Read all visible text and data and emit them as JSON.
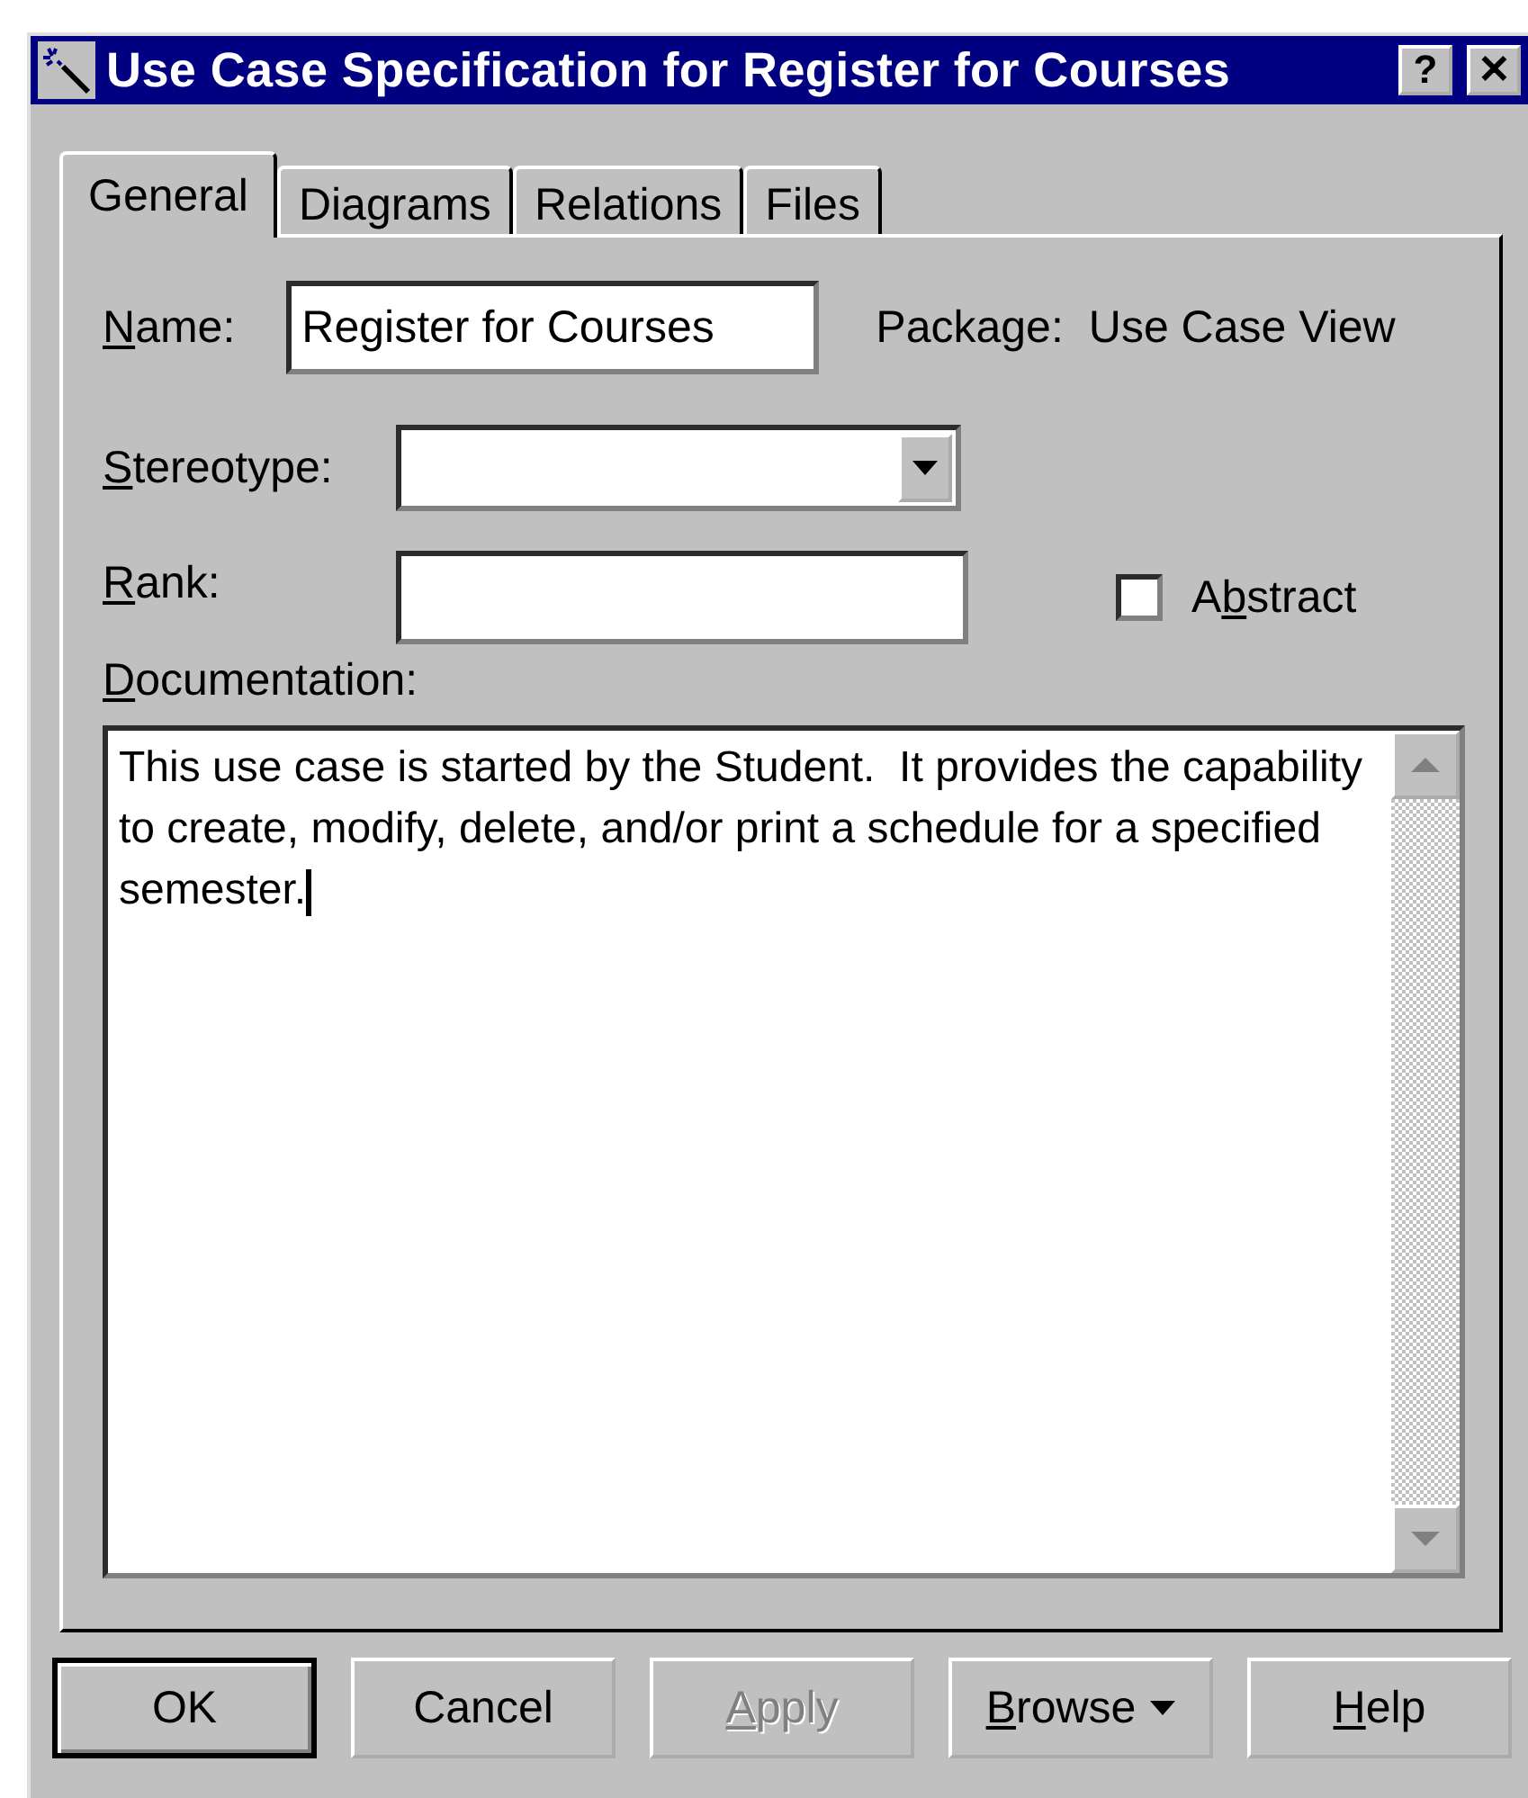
{
  "window": {
    "title": "Use Case Specification for Register for Courses",
    "help_button": "?",
    "close_button": "✕"
  },
  "tabs": [
    {
      "label": "General",
      "selected": true
    },
    {
      "label": "Diagrams",
      "selected": false
    },
    {
      "label": "Relations",
      "selected": false
    },
    {
      "label": "Files",
      "selected": false
    }
  ],
  "name_field": {
    "label": {
      "key": "N",
      "post": "ame:"
    },
    "value": "Register for Courses"
  },
  "package": {
    "label": "Package:",
    "value": "Use Case View"
  },
  "stereotype": {
    "label": {
      "key": "S",
      "post": "tereotype:"
    }
  },
  "rank": {
    "label": {
      "key": "R",
      "post": "ank:"
    }
  },
  "abstract": {
    "label": {
      "pre": "A",
      "key": "b",
      "post": "stract"
    },
    "checked": false
  },
  "documentation": {
    "label": {
      "key": "D",
      "post": "ocumentation:"
    },
    "value": "This use case is started by the Student.  It provides the capability to create, modify, delete, and/or print a schedule for a specified semester."
  },
  "buttons": [
    {
      "label": {
        "post": "OK"
      },
      "default": true,
      "disabled": false,
      "menu": false
    },
    {
      "label": {
        "post": "Cancel"
      },
      "default": false,
      "disabled": false,
      "menu": false
    },
    {
      "label": {
        "key": "A",
        "post": "pply"
      },
      "default": false,
      "disabled": true,
      "menu": false
    },
    {
      "label": {
        "key": "B",
        "post": "rowse"
      },
      "default": false,
      "disabled": false,
      "menu": true
    },
    {
      "label": {
        "key": "H",
        "post": "elp"
      },
      "default": false,
      "disabled": false,
      "menu": false
    }
  ]
}
